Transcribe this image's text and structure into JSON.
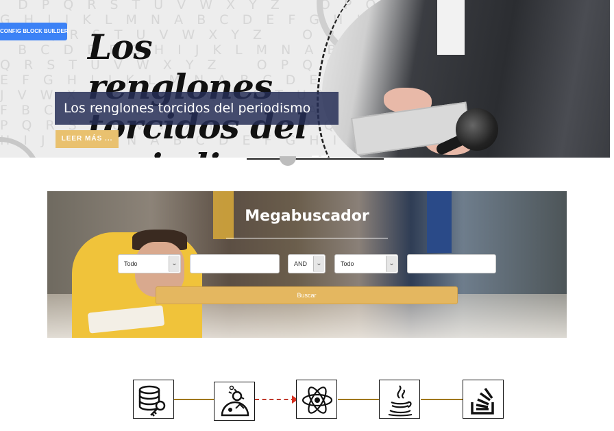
{
  "hero": {
    "background_letters": "  D P Q R S T U V W X Y Z    O P Q R S T U V W X\nG H I J K L M N A B C D E F G H I J K L M N A B\nO P Q R S T U V W X Y Z    O P Q R S T U V W X\n  B C D E F G H I J K L M N A B C D E F G H I J\nQ R S T U V W X Y Z    O P Q R S T U V W X Y Z\nE F G H I J K L M N A B C D E F G H I J K L M N\nJ V W X Y Z    O P Q R S T U V W X Y Z    O P\nF B C D E F G H I J K L M N A B C D E F G H I J\nP Q R S T U V W X Y Z    O P Q R S T U V W X Y\nH I J K L M N A B C D E F G H I J K L M N A B C",
    "script_title": "Los renglones torcidos del periodismo.",
    "caption": "Los renglones torcidos del periodismo",
    "read_more": "LEER MÁS ...",
    "config_button": "CONFIG BLOCK BUILDER"
  },
  "search": {
    "title": "Megabuscador",
    "field1": {
      "selected": "Todo"
    },
    "field1_text": "",
    "operator": {
      "selected": "AND"
    },
    "field2": {
      "selected": "Todo"
    },
    "field2_text": "",
    "button_label": "Buscar"
  },
  "chain": {
    "nodes": [
      "database-key-icon",
      "bug-robot-icon",
      "react-atom-icon",
      "java-icon",
      "stackoverflow-icon"
    ],
    "link_colors": {
      "normal": "#a07818",
      "highlighted": "#d62f1f"
    },
    "stub_text": "·   ·"
  }
}
